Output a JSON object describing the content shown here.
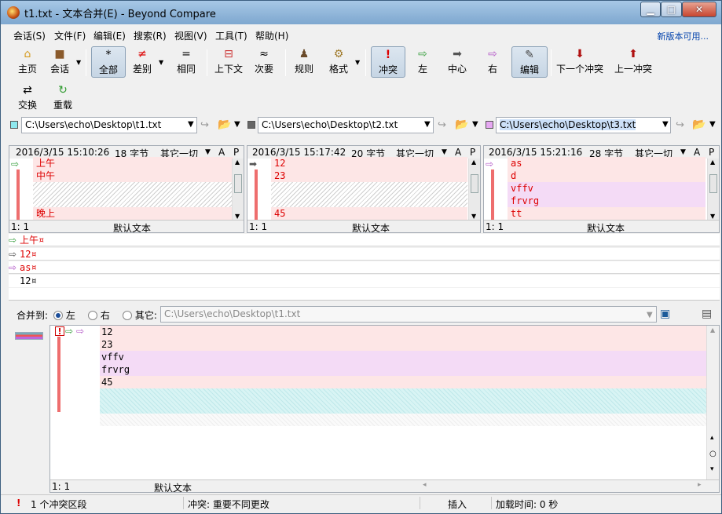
{
  "window": {
    "title": "t1.txt - 文本合并(E) - Beyond Compare"
  },
  "menu": {
    "items": [
      "会话(S)",
      "文件(F)",
      "编辑(E)",
      "搜索(R)",
      "视图(V)",
      "工具(T)",
      "帮助(H)"
    ],
    "right_link": "新版本可用..."
  },
  "toolbar": {
    "home": "主页",
    "session": "会话",
    "all": "全部",
    "diffs": "差别",
    "same": "相同",
    "context": "上下文",
    "minor": "次要",
    "rules": "规则",
    "format": "格式",
    "conflicts": "冲突",
    "left": "左",
    "center": "中心",
    "right": "右",
    "edit": "编辑",
    "next_conflict": "下一个冲突",
    "prev_conflict": "上一冲突",
    "swap": "交换",
    "reload": "重载"
  },
  "paths": {
    "left": "C:\\Users\\echo\\Desktop\\t1.txt",
    "center": "C:\\Users\\echo\\Desktop\\t2.txt",
    "right": "C:\\Users\\echo\\Desktop\\t3.txt"
  },
  "panes": [
    {
      "date": "2016/3/15 15:10:26",
      "size": "18 字节",
      "encoding": "其它一切",
      "a": "A",
      "p": "P",
      "lines": [
        "上午",
        "中午",
        "",
        "",
        "晚上"
      ],
      "pos": "1: 1",
      "format": "默认文本"
    },
    {
      "date": "2016/3/15 15:17:42",
      "size": "20 字节",
      "encoding": "其它一切",
      "a": "A",
      "p": "P",
      "lines": [
        "12",
        "23",
        "",
        "",
        "45"
      ],
      "pos": "1: 1",
      "format": "默认文本"
    },
    {
      "date": "2016/3/15 15:21:16",
      "size": "28 字节",
      "encoding": "其它一切",
      "a": "A",
      "p": "P",
      "lines": [
        "as",
        "d",
        "vffv",
        "frvrg",
        "tt"
      ],
      "pos": "1: 1",
      "format": "默认文本"
    }
  ],
  "merge_rows": [
    {
      "arrow": "⇨",
      "text": "上午¤"
    },
    {
      "arrow": "⇨",
      "text": "12¤"
    },
    {
      "arrow": "⇨",
      "text": "as¤"
    },
    {
      "arrow": "",
      "text": "12¤"
    }
  ],
  "merge_to": {
    "label": "合并到:",
    "left": "左",
    "right": "右",
    "other": "其它:",
    "selected": "左",
    "path": "C:\\Users\\echo\\Desktop\\t1.txt"
  },
  "output": {
    "lines": [
      "12",
      "23",
      "vffv",
      "frvrg",
      "45"
    ],
    "pos": "1: 1",
    "format": "默认文本"
  },
  "status": {
    "conflicts": "1 个冲突区段",
    "conflict_desc": "冲突: 重要不同更改",
    "mode": "插入",
    "load_time": "加载时间: 0 秒"
  },
  "colors": {
    "diff_bar": "#ee6e6e",
    "line_pink": "#fde6e6",
    "line_purple": "#f4dbf6",
    "diff_text": "#dd0000"
  }
}
